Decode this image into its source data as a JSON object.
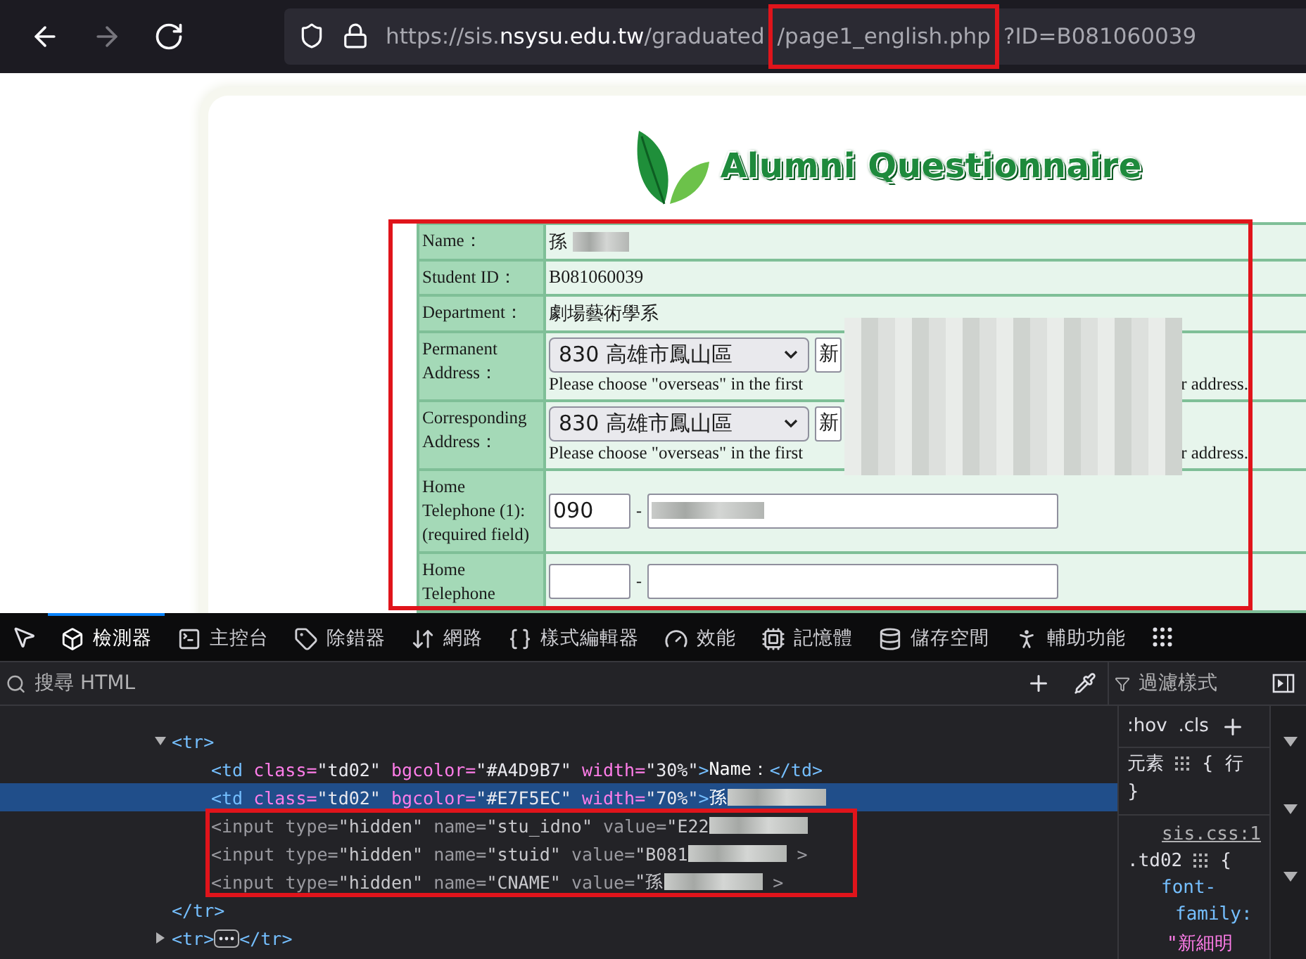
{
  "browser": {
    "nav": [
      {
        "disabled": false
      },
      {
        "disabled": true
      },
      {
        "disabled": false
      }
    ],
    "url": {
      "scheme": "https://sis.",
      "host": "nsysu.edu.tw",
      "path": "/graduated",
      "highlighted": "/page1_english.php",
      "query": "?ID=B081060039"
    }
  },
  "page": {
    "title": "Alumni Questionnaire",
    "rows": [
      {
        "kind": "text",
        "label": "Name：",
        "value": "孫",
        "redacted": true
      },
      {
        "kind": "text",
        "label": "Student ID：",
        "value": "B081060039"
      },
      {
        "kind": "text",
        "label": "Department：",
        "value": "劇場藝術學系"
      },
      {
        "kind": "address",
        "label": "Permanent Address：",
        "select": "830 高雄市鳳山區",
        "value": "新",
        "hint_start": "Please choose \"overseas\" in the first",
        "hint_end": "r address."
      },
      {
        "kind": "address",
        "label": "Corresponding Address：",
        "select": "830 高雄市鳳山區",
        "value": "新",
        "hint_start": "Please choose \"overseas\" in the first",
        "hint_end": "r address."
      },
      {
        "kind": "phone",
        "label": "Home Telephone (1):(required field)",
        "area": "090",
        "separator": "-",
        "redacted": true
      },
      {
        "kind": "phone",
        "label": "Home Telephone",
        "separator": "-"
      }
    ]
  },
  "devtools": {
    "tabs": [
      {
        "label": "檢測器",
        "selected": true
      },
      {
        "label": "主控台",
        "selected": false
      },
      {
        "label": "除錯器",
        "selected": false
      },
      {
        "label": "網路",
        "selected": false
      },
      {
        "label": "樣式編輯器",
        "selected": false
      },
      {
        "label": "效能",
        "selected": false
      },
      {
        "label": "記憶體",
        "selected": false
      },
      {
        "label": "儲存空間",
        "selected": false
      },
      {
        "label": "輔助功能",
        "selected": false
      }
    ],
    "search": {
      "placeholder": "搜尋 HTML"
    },
    "filter": {
      "placeholder": "過濾樣式"
    },
    "tree": [
      {
        "open": "<tr",
        "end": ">",
        "close": "</tr>",
        "expanded": true,
        "selected": false,
        "dimmed": false,
        "children": [
          {
            "open": "<td",
            "attrs": [
              {
                "name": "class=",
                "value": "\"td02\""
              },
              {
                "name": "bgcolor=",
                "value": "\"#A4D9B7\""
              },
              {
                "name": "width=",
                "value": "\"30%\""
              }
            ],
            "end": ">",
            "text": "Name：",
            "close": "</td>",
            "selected": false,
            "dimmed": false
          },
          {
            "open": "<td",
            "attrs": [
              {
                "name": "class=",
                "value": "\"td02\""
              },
              {
                "name": "bgcolor=",
                "value": "\"#E7F5EC\""
              },
              {
                "name": "width=",
                "value": "\"70%\""
              }
            ],
            "end": ">",
            "text": "孫",
            "redacted": true,
            "selected": true,
            "dimmed": false
          },
          {
            "open": "<input",
            "attrs": [
              {
                "name": "type=",
                "value": "\"hidden\""
              },
              {
                "name": "name=",
                "value": "\"stu_idno\""
              },
              {
                "name": "value=",
                "value": "\"E22"
              }
            ],
            "redacted": true,
            "selected": false,
            "dimmed": true
          },
          {
            "open": "<input",
            "attrs": [
              {
                "name": "type=",
                "value": "\"hidden\""
              },
              {
                "name": "name=",
                "value": "\"stuid\""
              },
              {
                "name": "value=",
                "value": "\"B081"
              }
            ],
            "redacted": true,
            "tail": ">",
            "selected": false,
            "dimmed": true
          },
          {
            "open": "<input",
            "attrs": [
              {
                "name": "type=",
                "value": "\"hidden\""
              },
              {
                "name": "name=",
                "value": "\"CNAME\""
              },
              {
                "name": "value=",
                "value": "\"孫"
              }
            ],
            "redacted": true,
            "tail": ">",
            "selected": false,
            "dimmed": true
          }
        ]
      },
      {
        "open": "<tr",
        "end": ">",
        "close": "</tr>",
        "expanded": false,
        "selected": false,
        "dimmed": false
      }
    ],
    "rules": {
      "pseudo": ":hov",
      "cls": ".cls",
      "element": "元素",
      "element_brace": "{",
      "element_cut": "行",
      "close": "}",
      "source": "sis.css:1",
      "selector": ".td02",
      "selector_brace": "{",
      "prop_1": "font-",
      "prop_2": "family:",
      "value": "\"新細明"
    }
  }
}
